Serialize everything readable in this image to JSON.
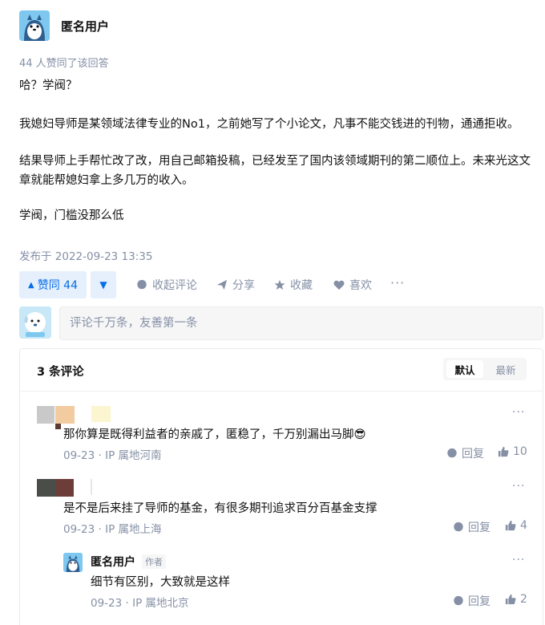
{
  "answer": {
    "author_name": "匿名用户",
    "votes_summary": "44 人赞同了该回答",
    "paragraphs": [
      "哈？学阀？",
      "我媳妇导师是某领域法律专业的No1，之前她写了个小论文，凡事不能交钱进的刊物，通通拒收。",
      "结果导师上手帮忙改了改，用自己邮箱投稿，已经发至了国内该领域期刊的第二顺位上。未来光这文章就能帮媳妇拿上多几万的收入。",
      "学阀，门槛没那么低"
    ],
    "post_date": "发布于 2022-09-23 13:35"
  },
  "actions": {
    "vote_up_label": "赞同 44",
    "collapse_comments": "收起评论",
    "share": "分享",
    "favorite": "收藏",
    "like": "喜欢",
    "more": "···"
  },
  "comment_box": {
    "placeholder": "评论千万条，友善第一条"
  },
  "comments_panel": {
    "count_label": "3 条评论",
    "sort_default": "默认",
    "sort_latest": "最新",
    "comments": [
      {
        "text": "那你算是既得利益者的亲戚了，匿稳了，千万别漏出马脚😎",
        "meta": "09-23 · IP 属地河南",
        "reply": "回复",
        "likes": "10",
        "more": "···"
      },
      {
        "text": "是不是后来挂了导师的基金，有很多期刊追求百分百基金支撑",
        "meta": "09-23 · IP 属地上海",
        "reply": "回复",
        "likes": "4",
        "more": "···"
      }
    ],
    "sub_comment": {
      "author": "匿名用户",
      "badge": "作者",
      "text": "细节有区别，大致就是这样",
      "meta": "09-23 · IP 属地北京",
      "reply": "回复",
      "likes": "2",
      "more": "···"
    }
  },
  "colors": {
    "brand": "#056de8",
    "muted": "#8590a6",
    "text": "#121212"
  }
}
